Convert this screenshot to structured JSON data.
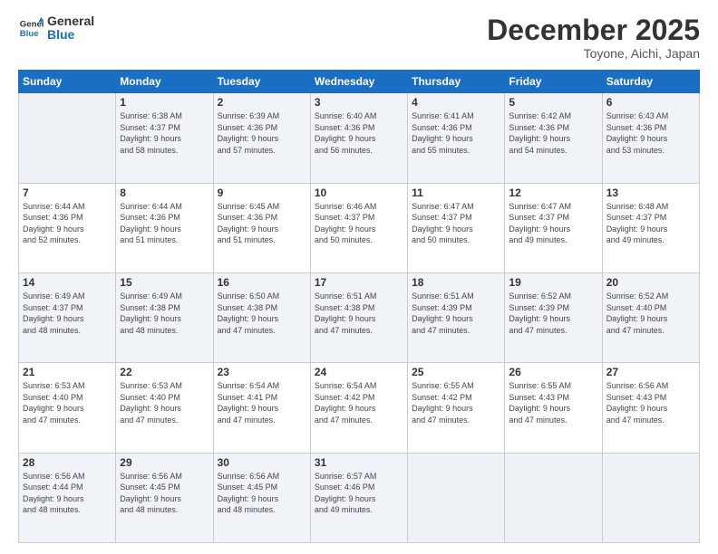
{
  "logo": {
    "line1": "General",
    "line2": "Blue"
  },
  "header": {
    "month": "December 2025",
    "location": "Toyone, Aichi, Japan"
  },
  "weekdays": [
    "Sunday",
    "Monday",
    "Tuesday",
    "Wednesday",
    "Thursday",
    "Friday",
    "Saturday"
  ],
  "weeks": [
    [
      {
        "day": "",
        "sunrise": "",
        "sunset": "",
        "daylight": "",
        "empty": true
      },
      {
        "day": "1",
        "sunrise": "Sunrise: 6:38 AM",
        "sunset": "Sunset: 4:37 PM",
        "daylight": "Daylight: 9 hours and 58 minutes."
      },
      {
        "day": "2",
        "sunrise": "Sunrise: 6:39 AM",
        "sunset": "Sunset: 4:36 PM",
        "daylight": "Daylight: 9 hours and 57 minutes."
      },
      {
        "day": "3",
        "sunrise": "Sunrise: 6:40 AM",
        "sunset": "Sunset: 4:36 PM",
        "daylight": "Daylight: 9 hours and 56 minutes."
      },
      {
        "day": "4",
        "sunrise": "Sunrise: 6:41 AM",
        "sunset": "Sunset: 4:36 PM",
        "daylight": "Daylight: 9 hours and 55 minutes."
      },
      {
        "day": "5",
        "sunrise": "Sunrise: 6:42 AM",
        "sunset": "Sunset: 4:36 PM",
        "daylight": "Daylight: 9 hours and 54 minutes."
      },
      {
        "day": "6",
        "sunrise": "Sunrise: 6:43 AM",
        "sunset": "Sunset: 4:36 PM",
        "daylight": "Daylight: 9 hours and 53 minutes."
      }
    ],
    [
      {
        "day": "7",
        "sunrise": "Sunrise: 6:44 AM",
        "sunset": "Sunset: 4:36 PM",
        "daylight": "Daylight: 9 hours and 52 minutes."
      },
      {
        "day": "8",
        "sunrise": "Sunrise: 6:44 AM",
        "sunset": "Sunset: 4:36 PM",
        "daylight": "Daylight: 9 hours and 51 minutes."
      },
      {
        "day": "9",
        "sunrise": "Sunrise: 6:45 AM",
        "sunset": "Sunset: 4:36 PM",
        "daylight": "Daylight: 9 hours and 51 minutes."
      },
      {
        "day": "10",
        "sunrise": "Sunrise: 6:46 AM",
        "sunset": "Sunset: 4:37 PM",
        "daylight": "Daylight: 9 hours and 50 minutes."
      },
      {
        "day": "11",
        "sunrise": "Sunrise: 6:47 AM",
        "sunset": "Sunset: 4:37 PM",
        "daylight": "Daylight: 9 hours and 50 minutes."
      },
      {
        "day": "12",
        "sunrise": "Sunrise: 6:47 AM",
        "sunset": "Sunset: 4:37 PM",
        "daylight": "Daylight: 9 hours and 49 minutes."
      },
      {
        "day": "13",
        "sunrise": "Sunrise: 6:48 AM",
        "sunset": "Sunset: 4:37 PM",
        "daylight": "Daylight: 9 hours and 49 minutes."
      }
    ],
    [
      {
        "day": "14",
        "sunrise": "Sunrise: 6:49 AM",
        "sunset": "Sunset: 4:37 PM",
        "daylight": "Daylight: 9 hours and 48 minutes."
      },
      {
        "day": "15",
        "sunrise": "Sunrise: 6:49 AM",
        "sunset": "Sunset: 4:38 PM",
        "daylight": "Daylight: 9 hours and 48 minutes."
      },
      {
        "day": "16",
        "sunrise": "Sunrise: 6:50 AM",
        "sunset": "Sunset: 4:38 PM",
        "daylight": "Daylight: 9 hours and 47 minutes."
      },
      {
        "day": "17",
        "sunrise": "Sunrise: 6:51 AM",
        "sunset": "Sunset: 4:38 PM",
        "daylight": "Daylight: 9 hours and 47 minutes."
      },
      {
        "day": "18",
        "sunrise": "Sunrise: 6:51 AM",
        "sunset": "Sunset: 4:39 PM",
        "daylight": "Daylight: 9 hours and 47 minutes."
      },
      {
        "day": "19",
        "sunrise": "Sunrise: 6:52 AM",
        "sunset": "Sunset: 4:39 PM",
        "daylight": "Daylight: 9 hours and 47 minutes."
      },
      {
        "day": "20",
        "sunrise": "Sunrise: 6:52 AM",
        "sunset": "Sunset: 4:40 PM",
        "daylight": "Daylight: 9 hours and 47 minutes."
      }
    ],
    [
      {
        "day": "21",
        "sunrise": "Sunrise: 6:53 AM",
        "sunset": "Sunset: 4:40 PM",
        "daylight": "Daylight: 9 hours and 47 minutes."
      },
      {
        "day": "22",
        "sunrise": "Sunrise: 6:53 AM",
        "sunset": "Sunset: 4:40 PM",
        "daylight": "Daylight: 9 hours and 47 minutes."
      },
      {
        "day": "23",
        "sunrise": "Sunrise: 6:54 AM",
        "sunset": "Sunset: 4:41 PM",
        "daylight": "Daylight: 9 hours and 47 minutes."
      },
      {
        "day": "24",
        "sunrise": "Sunrise: 6:54 AM",
        "sunset": "Sunset: 4:42 PM",
        "daylight": "Daylight: 9 hours and 47 minutes."
      },
      {
        "day": "25",
        "sunrise": "Sunrise: 6:55 AM",
        "sunset": "Sunset: 4:42 PM",
        "daylight": "Daylight: 9 hours and 47 minutes."
      },
      {
        "day": "26",
        "sunrise": "Sunrise: 6:55 AM",
        "sunset": "Sunset: 4:43 PM",
        "daylight": "Daylight: 9 hours and 47 minutes."
      },
      {
        "day": "27",
        "sunrise": "Sunrise: 6:56 AM",
        "sunset": "Sunset: 4:43 PM",
        "daylight": "Daylight: 9 hours and 47 minutes."
      }
    ],
    [
      {
        "day": "28",
        "sunrise": "Sunrise: 6:56 AM",
        "sunset": "Sunset: 4:44 PM",
        "daylight": "Daylight: 9 hours and 48 minutes."
      },
      {
        "day": "29",
        "sunrise": "Sunrise: 6:56 AM",
        "sunset": "Sunset: 4:45 PM",
        "daylight": "Daylight: 9 hours and 48 minutes."
      },
      {
        "day": "30",
        "sunrise": "Sunrise: 6:56 AM",
        "sunset": "Sunset: 4:45 PM",
        "daylight": "Daylight: 9 hours and 48 minutes."
      },
      {
        "day": "31",
        "sunrise": "Sunrise: 6:57 AM",
        "sunset": "Sunset: 4:46 PM",
        "daylight": "Daylight: 9 hours and 49 minutes."
      },
      {
        "day": "",
        "sunrise": "",
        "sunset": "",
        "daylight": "",
        "empty": true
      },
      {
        "day": "",
        "sunrise": "",
        "sunset": "",
        "daylight": "",
        "empty": true
      },
      {
        "day": "",
        "sunrise": "",
        "sunset": "",
        "daylight": "",
        "empty": true
      }
    ]
  ]
}
